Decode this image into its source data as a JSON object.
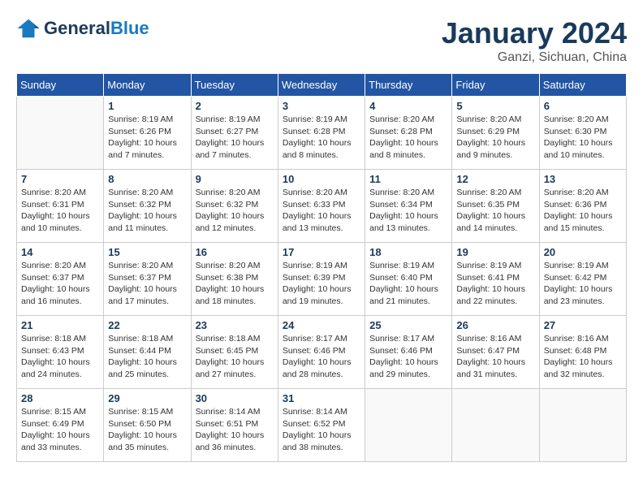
{
  "header": {
    "logo_general": "General",
    "logo_blue": "Blue",
    "month": "January 2024",
    "location": "Ganzi, Sichuan, China"
  },
  "days_of_week": [
    "Sunday",
    "Monday",
    "Tuesday",
    "Wednesday",
    "Thursday",
    "Friday",
    "Saturday"
  ],
  "weeks": [
    [
      {
        "day": "",
        "sunrise": "",
        "sunset": "",
        "daylight": ""
      },
      {
        "day": "1",
        "sunrise": "Sunrise: 8:19 AM",
        "sunset": "Sunset: 6:26 PM",
        "daylight": "Daylight: 10 hours and 7 minutes."
      },
      {
        "day": "2",
        "sunrise": "Sunrise: 8:19 AM",
        "sunset": "Sunset: 6:27 PM",
        "daylight": "Daylight: 10 hours and 7 minutes."
      },
      {
        "day": "3",
        "sunrise": "Sunrise: 8:19 AM",
        "sunset": "Sunset: 6:28 PM",
        "daylight": "Daylight: 10 hours and 8 minutes."
      },
      {
        "day": "4",
        "sunrise": "Sunrise: 8:20 AM",
        "sunset": "Sunset: 6:28 PM",
        "daylight": "Daylight: 10 hours and 8 minutes."
      },
      {
        "day": "5",
        "sunrise": "Sunrise: 8:20 AM",
        "sunset": "Sunset: 6:29 PM",
        "daylight": "Daylight: 10 hours and 9 minutes."
      },
      {
        "day": "6",
        "sunrise": "Sunrise: 8:20 AM",
        "sunset": "Sunset: 6:30 PM",
        "daylight": "Daylight: 10 hours and 10 minutes."
      }
    ],
    [
      {
        "day": "7",
        "sunrise": "Sunrise: 8:20 AM",
        "sunset": "Sunset: 6:31 PM",
        "daylight": "Daylight: 10 hours and 10 minutes."
      },
      {
        "day": "8",
        "sunrise": "Sunrise: 8:20 AM",
        "sunset": "Sunset: 6:32 PM",
        "daylight": "Daylight: 10 hours and 11 minutes."
      },
      {
        "day": "9",
        "sunrise": "Sunrise: 8:20 AM",
        "sunset": "Sunset: 6:32 PM",
        "daylight": "Daylight: 10 hours and 12 minutes."
      },
      {
        "day": "10",
        "sunrise": "Sunrise: 8:20 AM",
        "sunset": "Sunset: 6:33 PM",
        "daylight": "Daylight: 10 hours and 13 minutes."
      },
      {
        "day": "11",
        "sunrise": "Sunrise: 8:20 AM",
        "sunset": "Sunset: 6:34 PM",
        "daylight": "Daylight: 10 hours and 13 minutes."
      },
      {
        "day": "12",
        "sunrise": "Sunrise: 8:20 AM",
        "sunset": "Sunset: 6:35 PM",
        "daylight": "Daylight: 10 hours and 14 minutes."
      },
      {
        "day": "13",
        "sunrise": "Sunrise: 8:20 AM",
        "sunset": "Sunset: 6:36 PM",
        "daylight": "Daylight: 10 hours and 15 minutes."
      }
    ],
    [
      {
        "day": "14",
        "sunrise": "Sunrise: 8:20 AM",
        "sunset": "Sunset: 6:37 PM",
        "daylight": "Daylight: 10 hours and 16 minutes."
      },
      {
        "day": "15",
        "sunrise": "Sunrise: 8:20 AM",
        "sunset": "Sunset: 6:37 PM",
        "daylight": "Daylight: 10 hours and 17 minutes."
      },
      {
        "day": "16",
        "sunrise": "Sunrise: 8:20 AM",
        "sunset": "Sunset: 6:38 PM",
        "daylight": "Daylight: 10 hours and 18 minutes."
      },
      {
        "day": "17",
        "sunrise": "Sunrise: 8:19 AM",
        "sunset": "Sunset: 6:39 PM",
        "daylight": "Daylight: 10 hours and 19 minutes."
      },
      {
        "day": "18",
        "sunrise": "Sunrise: 8:19 AM",
        "sunset": "Sunset: 6:40 PM",
        "daylight": "Daylight: 10 hours and 21 minutes."
      },
      {
        "day": "19",
        "sunrise": "Sunrise: 8:19 AM",
        "sunset": "Sunset: 6:41 PM",
        "daylight": "Daylight: 10 hours and 22 minutes."
      },
      {
        "day": "20",
        "sunrise": "Sunrise: 8:19 AM",
        "sunset": "Sunset: 6:42 PM",
        "daylight": "Daylight: 10 hours and 23 minutes."
      }
    ],
    [
      {
        "day": "21",
        "sunrise": "Sunrise: 8:18 AM",
        "sunset": "Sunset: 6:43 PM",
        "daylight": "Daylight: 10 hours and 24 minutes."
      },
      {
        "day": "22",
        "sunrise": "Sunrise: 8:18 AM",
        "sunset": "Sunset: 6:44 PM",
        "daylight": "Daylight: 10 hours and 25 minutes."
      },
      {
        "day": "23",
        "sunrise": "Sunrise: 8:18 AM",
        "sunset": "Sunset: 6:45 PM",
        "daylight": "Daylight: 10 hours and 27 minutes."
      },
      {
        "day": "24",
        "sunrise": "Sunrise: 8:17 AM",
        "sunset": "Sunset: 6:46 PM",
        "daylight": "Daylight: 10 hours and 28 minutes."
      },
      {
        "day": "25",
        "sunrise": "Sunrise: 8:17 AM",
        "sunset": "Sunset: 6:46 PM",
        "daylight": "Daylight: 10 hours and 29 minutes."
      },
      {
        "day": "26",
        "sunrise": "Sunrise: 8:16 AM",
        "sunset": "Sunset: 6:47 PM",
        "daylight": "Daylight: 10 hours and 31 minutes."
      },
      {
        "day": "27",
        "sunrise": "Sunrise: 8:16 AM",
        "sunset": "Sunset: 6:48 PM",
        "daylight": "Daylight: 10 hours and 32 minutes."
      }
    ],
    [
      {
        "day": "28",
        "sunrise": "Sunrise: 8:15 AM",
        "sunset": "Sunset: 6:49 PM",
        "daylight": "Daylight: 10 hours and 33 minutes."
      },
      {
        "day": "29",
        "sunrise": "Sunrise: 8:15 AM",
        "sunset": "Sunset: 6:50 PM",
        "daylight": "Daylight: 10 hours and 35 minutes."
      },
      {
        "day": "30",
        "sunrise": "Sunrise: 8:14 AM",
        "sunset": "Sunset: 6:51 PM",
        "daylight": "Daylight: 10 hours and 36 minutes."
      },
      {
        "day": "31",
        "sunrise": "Sunrise: 8:14 AM",
        "sunset": "Sunset: 6:52 PM",
        "daylight": "Daylight: 10 hours and 38 minutes."
      },
      {
        "day": "",
        "sunrise": "",
        "sunset": "",
        "daylight": ""
      },
      {
        "day": "",
        "sunrise": "",
        "sunset": "",
        "daylight": ""
      },
      {
        "day": "",
        "sunrise": "",
        "sunset": "",
        "daylight": ""
      }
    ]
  ]
}
